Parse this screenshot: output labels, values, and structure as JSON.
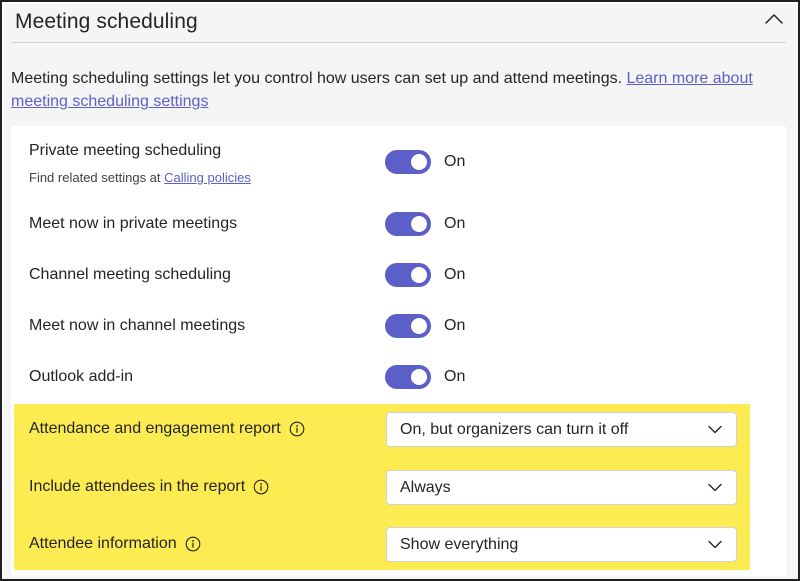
{
  "header": {
    "title": "Meeting scheduling"
  },
  "description": {
    "text": "Meeting scheduling settings let you control how users can set up and attend meetings. ",
    "link": "Learn more about meeting scheduling settings"
  },
  "toggles": [
    {
      "label": "Private meeting scheduling",
      "sub_prefix": "Find related settings at ",
      "sub_link": "Calling policies",
      "state": "On",
      "value": true
    },
    {
      "label": "Meet now in private meetings",
      "state": "On",
      "value": true
    },
    {
      "label": "Channel meeting scheduling",
      "state": "On",
      "value": true
    },
    {
      "label": "Meet now in channel meetings",
      "state": "On",
      "value": true
    },
    {
      "label": "Outlook add-in",
      "state": "On",
      "value": true
    }
  ],
  "dropdowns": [
    {
      "label": "Attendance and engagement report",
      "value": "On, but organizers can turn it off"
    },
    {
      "label": "Include attendees in the report",
      "value": "Always"
    },
    {
      "label": "Attendee information",
      "value": "Show everything"
    }
  ],
  "colors": {
    "accent": "#5b5fc7",
    "highlight": "#fdeb52"
  },
  "icons": {
    "collapse": "chevron-up-icon",
    "info": "info-icon",
    "dropdown": "chevron-down-icon"
  }
}
